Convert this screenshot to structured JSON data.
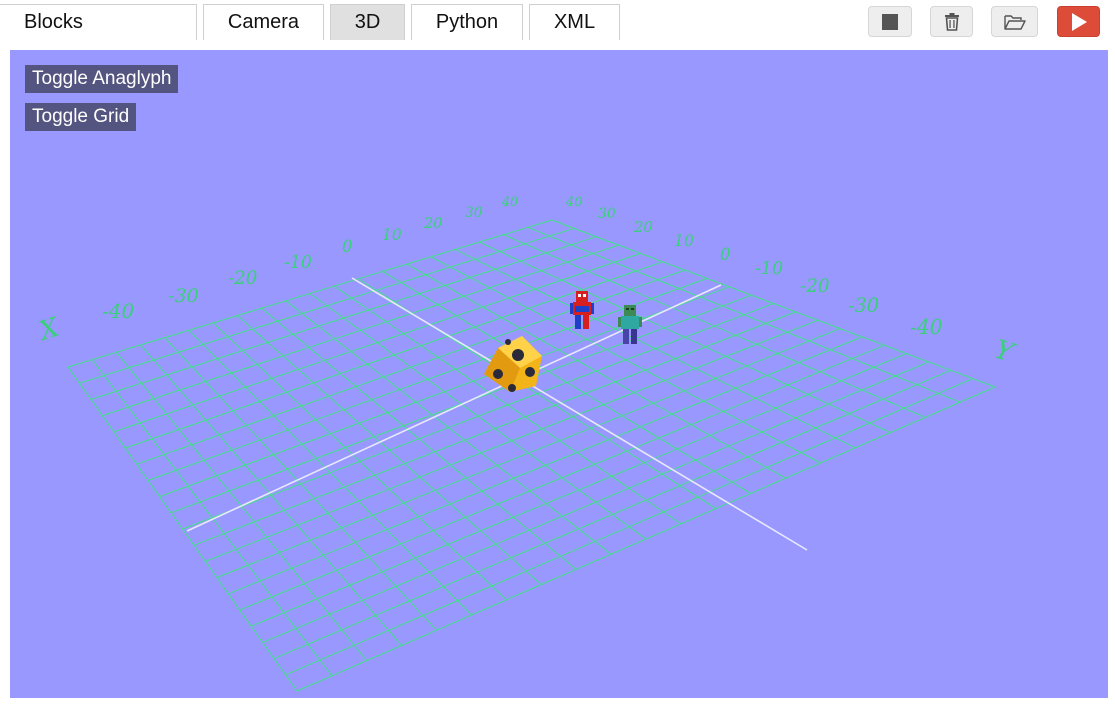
{
  "tabs": [
    {
      "label": "Blocks"
    },
    {
      "label": "Camera"
    },
    {
      "label": "3D"
    },
    {
      "label": "Python"
    },
    {
      "label": "XML"
    }
  ],
  "active_tab": "3D",
  "toolbar": {
    "stop": {
      "icon": "stop-icon"
    },
    "delete": {
      "icon": "trash-icon"
    },
    "open": {
      "icon": "folder-open-icon"
    },
    "run": {
      "icon": "play-icon"
    }
  },
  "viewport": {
    "background": "#9898ff",
    "grid_color": "#44e088",
    "axis_line_color": "#e8e8ff",
    "overlay_buttons": {
      "toggle_anaglyph": "Toggle Anaglyph",
      "toggle_grid": "Toggle Grid"
    },
    "axis_labels": {
      "x": "X",
      "y": "Y"
    },
    "x_ticks": [
      "-40",
      "-30",
      "-20",
      "-10",
      "0",
      "10",
      "20",
      "30",
      "40"
    ],
    "y_ticks": [
      "40",
      "30",
      "20",
      "10",
      "0",
      "-10",
      "-20",
      "-30",
      "-40"
    ],
    "objects": [
      {
        "name": "yellow-cube"
      },
      {
        "name": "spiderman-character"
      },
      {
        "name": "zombie-character"
      }
    ]
  },
  "colors": {
    "run_button": "#dd4b39",
    "active_tab": "#e0e0e0",
    "overlay_button": "#545480"
  }
}
